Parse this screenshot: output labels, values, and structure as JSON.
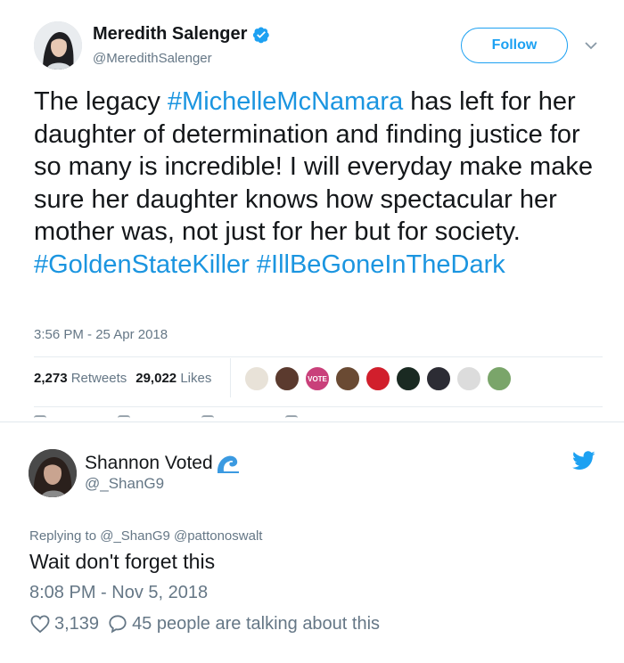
{
  "quoted_tweet": {
    "author_name": "Meredith Salenger",
    "author_handle": "@MeredithSalenger",
    "verified_icon": "verified-badge-icon",
    "follow_label": "Follow",
    "caret_icon": "chevron-down-icon",
    "body": {
      "text_before": "The legacy ",
      "hashtag_1": "#MichelleMcNamara",
      "text_after": " has left for her daughter of determination and finding justice for so many is incredible! I will everyday make make sure her daughter knows how spectacular her mother was, not just for her but for society.",
      "hashtag_2": "#GoldenStateKiller",
      "hashtag_3": "#IllBeGoneInTheDark"
    },
    "timestamp": "3:56 PM - 25 Apr 2018",
    "retweets_count": "2,273",
    "retweets_label": "Retweets",
    "likes_count": "29,022",
    "likes_label": "Likes",
    "liker_avatars": [
      {
        "name": "liker-avatar",
        "color": "#e8e2d8",
        "badge": ""
      },
      {
        "name": "liker-avatar",
        "color": "#5b3a2e",
        "badge": ""
      },
      {
        "name": "liker-avatar",
        "color": "#c9407a",
        "badge": "VOTE"
      },
      {
        "name": "liker-avatar",
        "color": "#6a4a33",
        "badge": ""
      },
      {
        "name": "liker-avatar",
        "color": "#d11f2c",
        "badge": ""
      },
      {
        "name": "liker-avatar",
        "color": "#1a2a22",
        "badge": ""
      },
      {
        "name": "liker-avatar",
        "color": "#2c2c34",
        "badge": ""
      },
      {
        "name": "liker-avatar",
        "color": "#dcdcdc",
        "badge": ""
      },
      {
        "name": "liker-avatar",
        "color": "#7aa56a",
        "badge": ""
      }
    ]
  },
  "reply_tweet": {
    "author_name": "Shannon Voted",
    "wave_emoji": "🌊",
    "author_handle": "@_ShanG9",
    "twitter_icon": "twitter-bird-icon",
    "replying_to": "Replying to @_ShanG9 @pattonoswalt",
    "text": "Wait don't forget this",
    "timestamp": "8:08 PM - Nov 5, 2018",
    "likes_count": "3,139",
    "talking_text": "45 people are talking about this"
  },
  "colors": {
    "twitter_blue": "#1da1f2",
    "hashtag_blue": "#1b95e0",
    "secondary_text": "#657786",
    "primary_text": "#14171a"
  }
}
